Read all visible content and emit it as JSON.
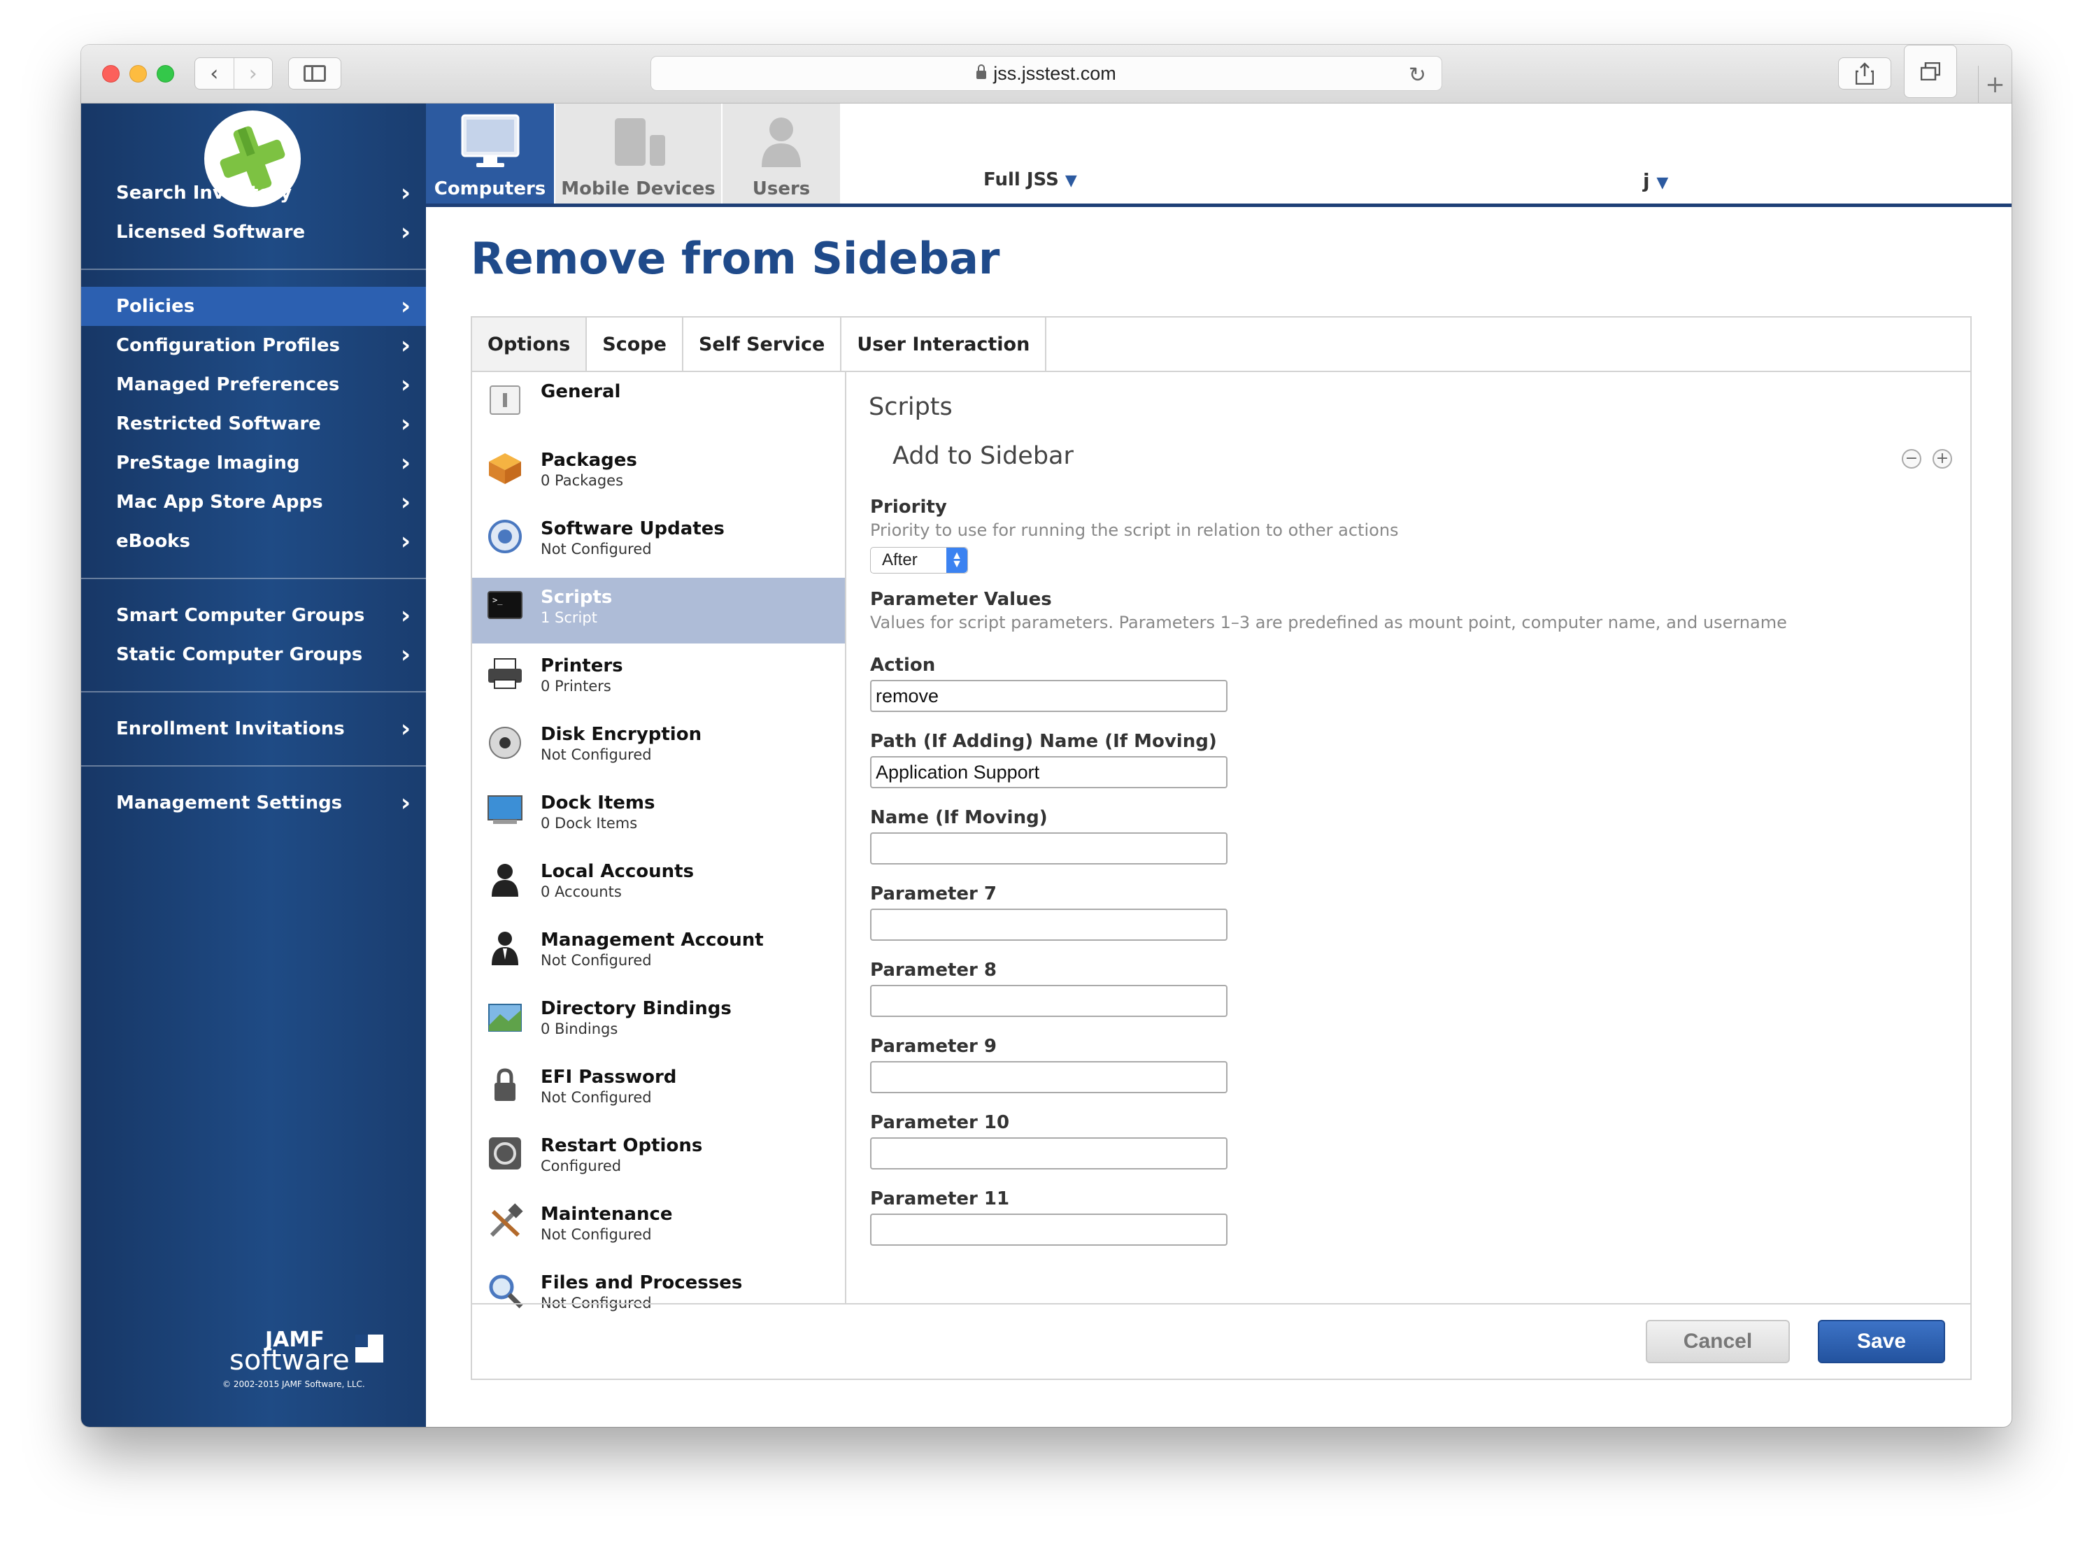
{
  "browser": {
    "url": "jss.jsstest.com"
  },
  "sidebar": {
    "groups": [
      [
        "Search Inventory",
        "Licensed Software"
      ],
      [
        "Policies",
        "Configuration Profiles",
        "Managed Preferences",
        "Restricted Software",
        "PreStage Imaging",
        "Mac App Store Apps",
        "eBooks"
      ],
      [
        "Smart Computer Groups",
        "Static Computer Groups"
      ],
      [
        "Enrollment Invitations"
      ],
      [
        "Management Settings"
      ]
    ],
    "active": "Policies",
    "brand_word": "JAMF",
    "brand_sub": "software",
    "copyright": "© 2002-2015 JAMF Software, LLC."
  },
  "topnav": {
    "tabs": [
      "Computers",
      "Mobile Devices",
      "Users"
    ],
    "active": "Computers",
    "environment": "Full JSS",
    "user": "j"
  },
  "page": {
    "title": "Remove from Sidebar"
  },
  "tabs": [
    "Options",
    "Scope",
    "Self Service",
    "User Interaction"
  ],
  "active_tab": "Options",
  "options": [
    {
      "name": "General",
      "sub": "",
      "icon": "general-icon"
    },
    {
      "name": "Packages",
      "sub": "0 Packages",
      "icon": "package-icon"
    },
    {
      "name": "Software Updates",
      "sub": "Not Configured",
      "icon": "software-update-icon"
    },
    {
      "name": "Scripts",
      "sub": "1 Script",
      "icon": "terminal-icon"
    },
    {
      "name": "Printers",
      "sub": "0 Printers",
      "icon": "printer-icon"
    },
    {
      "name": "Disk Encryption",
      "sub": "Not Configured",
      "icon": "disk-encryption-icon"
    },
    {
      "name": "Dock Items",
      "sub": "0 Dock Items",
      "icon": "dock-icon"
    },
    {
      "name": "Local Accounts",
      "sub": "0 Accounts",
      "icon": "user-icon"
    },
    {
      "name": "Management Account",
      "sub": "Not Configured",
      "icon": "admin-user-icon"
    },
    {
      "name": "Directory Bindings",
      "sub": "0 Bindings",
      "icon": "directory-icon"
    },
    {
      "name": "EFI Password",
      "sub": "Not Configured",
      "icon": "lock-icon"
    },
    {
      "name": "Restart Options",
      "sub": "Configured",
      "icon": "restart-icon"
    },
    {
      "name": "Maintenance",
      "sub": "Not Configured",
      "icon": "tools-icon"
    },
    {
      "name": "Files and Processes",
      "sub": "Not Configured",
      "icon": "magnifier-icon"
    }
  ],
  "active_option": "Scripts",
  "detail": {
    "section": "Scripts",
    "script_name": "Add to Sidebar",
    "priority_label": "Priority",
    "priority_desc": "Priority to use for running the script in relation to other actions",
    "priority_value": "After",
    "param_label": "Parameter Values",
    "param_desc": "Values for script parameters. Parameters 1–3 are predefined as mount point, computer name, and username",
    "fields": [
      {
        "label": "Action",
        "value": "remove"
      },
      {
        "label": "Path (If Adding) Name (If Moving)",
        "value": "Application Support"
      },
      {
        "label": "Name (If Moving)",
        "value": ""
      },
      {
        "label": "Parameter 7",
        "value": ""
      },
      {
        "label": "Parameter 8",
        "value": ""
      },
      {
        "label": "Parameter 9",
        "value": ""
      },
      {
        "label": "Parameter 10",
        "value": ""
      },
      {
        "label": "Parameter 11",
        "value": ""
      }
    ]
  },
  "buttons": {
    "cancel": "Cancel",
    "save": "Save"
  },
  "colors": {
    "accent": "#2c5aa0",
    "title": "#1f4a8a",
    "sidebar": "#1f4b85",
    "active_option": "#aebcd7"
  }
}
